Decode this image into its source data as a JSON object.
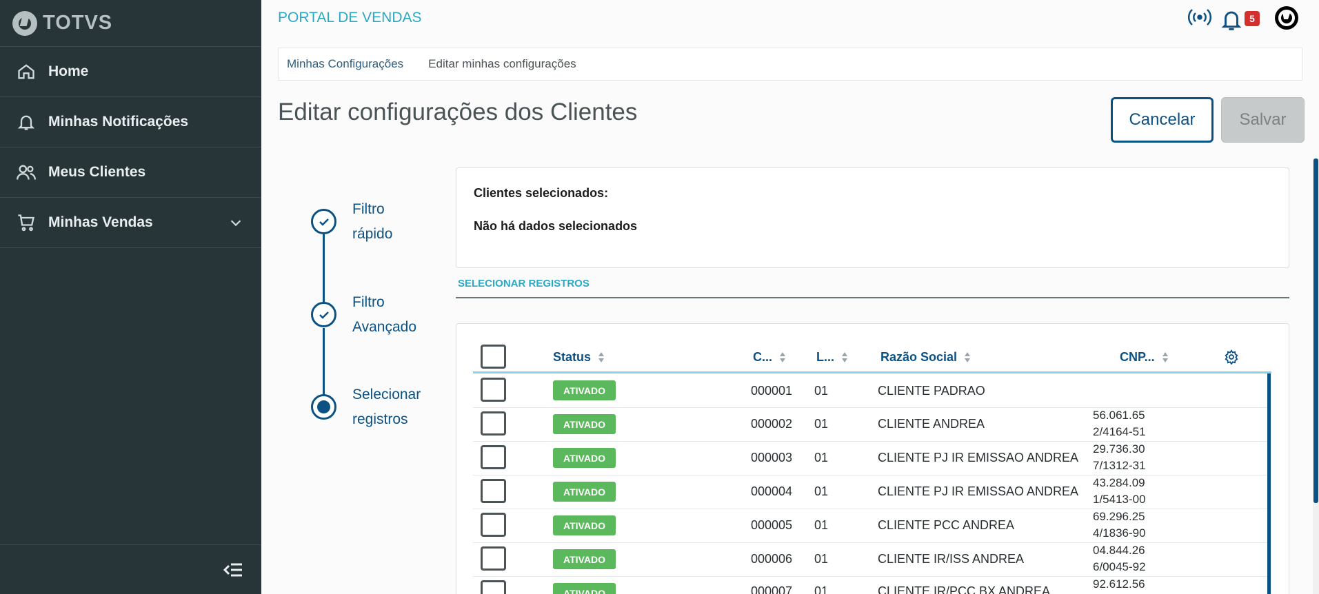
{
  "sidebar": {
    "logo": "TOTVS",
    "items": [
      {
        "label": "Home",
        "icon": "home-icon"
      },
      {
        "label": "Minhas Notificações",
        "icon": "bell-icon"
      },
      {
        "label": "Meus Clientes",
        "icon": "users-icon"
      },
      {
        "label": "Minhas Vendas",
        "icon": "cart-icon"
      }
    ]
  },
  "header": {
    "title": "PORTAL DE VENDAS",
    "notification_count": "5"
  },
  "breadcrumb": [
    "Minhas Configurações",
    "Editar minhas configurações"
  ],
  "page": {
    "title": "Editar configurações dos Clientes",
    "cancel_label": "Cancelar",
    "save_label": "Salvar"
  },
  "stepper": [
    {
      "line1": "Filtro",
      "line2": "rápido",
      "state": "done"
    },
    {
      "line1": "Filtro",
      "line2": "Avançado",
      "state": "done"
    },
    {
      "line1": "Selecionar",
      "line2": "registros",
      "state": "active"
    }
  ],
  "selected": {
    "title": "Clientes selecionados:",
    "message": "Não há dados selecionados"
  },
  "tab_label": "SELECIONAR REGISTROS",
  "table": {
    "columns": [
      "Status",
      "C...",
      "L...",
      "Razão Social",
      "CNP..."
    ],
    "rows": [
      {
        "status": "ATIVADO",
        "code": "000001",
        "loja": "01",
        "razao": "CLIENTE PADRAO",
        "cnpj1": "",
        "cnpj2": ""
      },
      {
        "status": "ATIVADO",
        "code": "000002",
        "loja": "01",
        "razao": "CLIENTE ANDREA",
        "cnpj1": "56.061.65",
        "cnpj2": "2/4164-51"
      },
      {
        "status": "ATIVADO",
        "code": "000003",
        "loja": "01",
        "razao": "CLIENTE PJ IR EMISSAO ANDREA",
        "cnpj1": "29.736.30",
        "cnpj2": "7/1312-31"
      },
      {
        "status": "ATIVADO",
        "code": "000004",
        "loja": "01",
        "razao": "CLIENTE PJ IR EMISSAO ANDREA",
        "cnpj1": "43.284.09",
        "cnpj2": "1/5413-00"
      },
      {
        "status": "ATIVADO",
        "code": "000005",
        "loja": "01",
        "razao": "CLIENTE PCC ANDREA",
        "cnpj1": "69.296.25",
        "cnpj2": "4/1836-90"
      },
      {
        "status": "ATIVADO",
        "code": "000006",
        "loja": "01",
        "razao": "CLIENTE IR/ISS ANDREA",
        "cnpj1": "04.844.26",
        "cnpj2": "6/0045-92"
      },
      {
        "status": "ATIVADO",
        "code": "000007",
        "loja": "01",
        "razao": "CLIENTE IR/PCC BX ANDREA",
        "cnpj1": "92.612.56",
        "cnpj2": ""
      }
    ]
  },
  "colors": {
    "sidebar_bg": "#283538",
    "primary": "#0c5184",
    "accent": "#2ba8c4",
    "status_green": "#5cb85c",
    "badge_red": "#d32f2f"
  }
}
